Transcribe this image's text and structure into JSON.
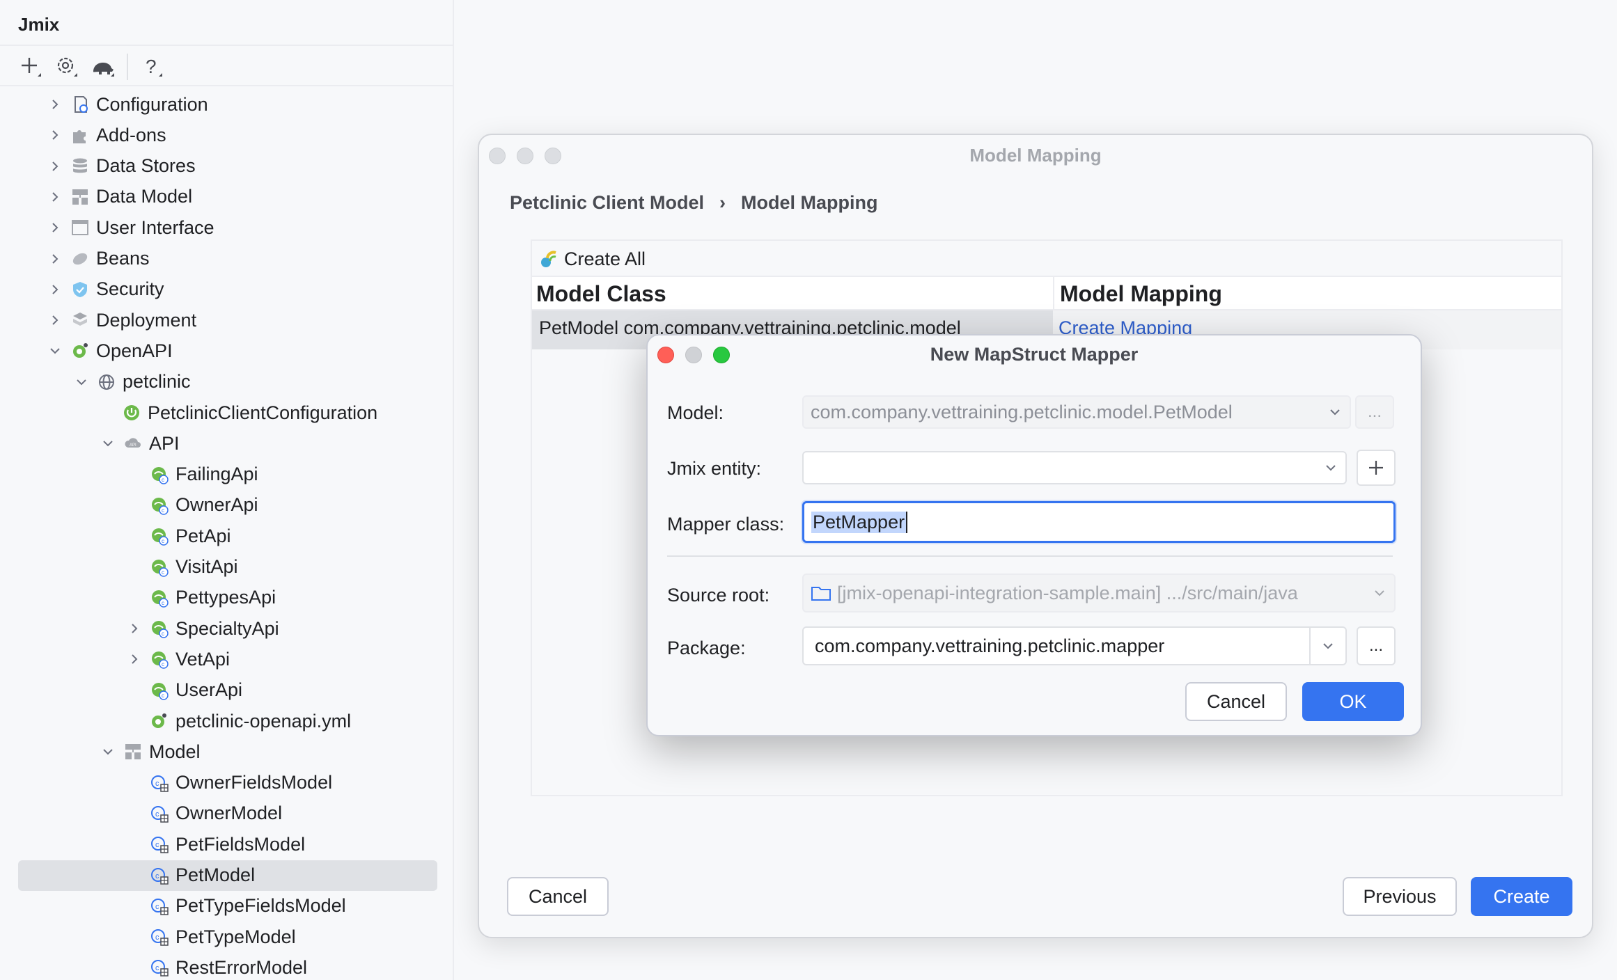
{
  "sidebar": {
    "title": "Jmix",
    "toolbar": {
      "add_icon": "plus-icon",
      "settings_icon": "gear-icon",
      "gradle_icon": "elephant-icon",
      "help_icon": "question-icon"
    },
    "tree": [
      {
        "label": "Configuration",
        "icon": "configuration-icon"
      },
      {
        "label": "Add-ons",
        "icon": "puzzle-icon"
      },
      {
        "label": "Data Stores",
        "icon": "database-icon"
      },
      {
        "label": "Data Model",
        "icon": "data-model-icon"
      },
      {
        "label": "User Interface",
        "icon": "window-icon"
      },
      {
        "label": "Beans",
        "icon": "bean-icon"
      },
      {
        "label": "Security",
        "icon": "shield-icon"
      },
      {
        "label": "Deployment",
        "icon": "deployment-icon"
      },
      {
        "label": "OpenAPI",
        "icon": "openapi-icon"
      },
      {
        "label": "petclinic",
        "icon": "globe-icon"
      },
      {
        "label": "PetclinicClientConfiguration",
        "icon": "spring-config-icon"
      },
      {
        "label": "API",
        "icon": "api-icon"
      },
      {
        "label": "FailingApi",
        "icon": "api-class-icon"
      },
      {
        "label": "OwnerApi",
        "icon": "api-class-icon"
      },
      {
        "label": "PetApi",
        "icon": "api-class-icon"
      },
      {
        "label": "VisitApi",
        "icon": "api-class-icon"
      },
      {
        "label": "PettypesApi",
        "icon": "api-class-icon"
      },
      {
        "label": "SpecialtyApi",
        "icon": "api-class-icon"
      },
      {
        "label": "VetApi",
        "icon": "api-class-icon"
      },
      {
        "label": "UserApi",
        "icon": "api-class-icon"
      },
      {
        "label": "petclinic-openapi.yml",
        "icon": "yaml-file-icon"
      },
      {
        "label": "Model",
        "icon": "data-model-icon"
      },
      {
        "label": "OwnerFieldsModel",
        "icon": "model-class-icon"
      },
      {
        "label": "OwnerModel",
        "icon": "model-class-icon"
      },
      {
        "label": "PetFieldsModel",
        "icon": "model-class-icon"
      },
      {
        "label": "PetModel",
        "icon": "model-class-icon"
      },
      {
        "label": "PetTypeFieldsModel",
        "icon": "model-class-icon"
      },
      {
        "label": "PetTypeModel",
        "icon": "model-class-icon"
      },
      {
        "label": "RestErrorModel",
        "icon": "model-class-icon"
      }
    ]
  },
  "wizard": {
    "title": "Model Mapping",
    "breadcrumb": [
      "Petclinic Client Model",
      "Model Mapping"
    ],
    "create_all": "Create All",
    "columns": [
      "Model Class",
      "Model Mapping"
    ],
    "rows": [
      {
        "model_class": "PetModel com.company.vettraining.petclinic.model",
        "mapping": "Create Mapping"
      }
    ],
    "cancel": "Cancel",
    "previous": "Previous",
    "create": "Create"
  },
  "dialog": {
    "title": "New MapStruct Mapper",
    "model_label": "Model:",
    "model_value": "com.company.vettraining.petclinic.model.PetModel",
    "model_browse": "...",
    "entity_label": "Jmix entity:",
    "entity_value": "",
    "mapper_label": "Mapper class:",
    "mapper_value": "PetMapper",
    "source_label": "Source root:",
    "source_value": "[jmix-openapi-integration-sample.main] .../src/main/java",
    "package_label": "Package:",
    "package_value": "com.company.vettraining.petclinic.mapper",
    "package_browse": "...",
    "cancel": "Cancel",
    "ok": "OK"
  },
  "colors": {
    "accent": "#3574f0",
    "link": "#2e5ecc",
    "traffic_red": "#ff5f57",
    "traffic_yellow": "#d0d2d6",
    "traffic_green": "#28c840"
  }
}
